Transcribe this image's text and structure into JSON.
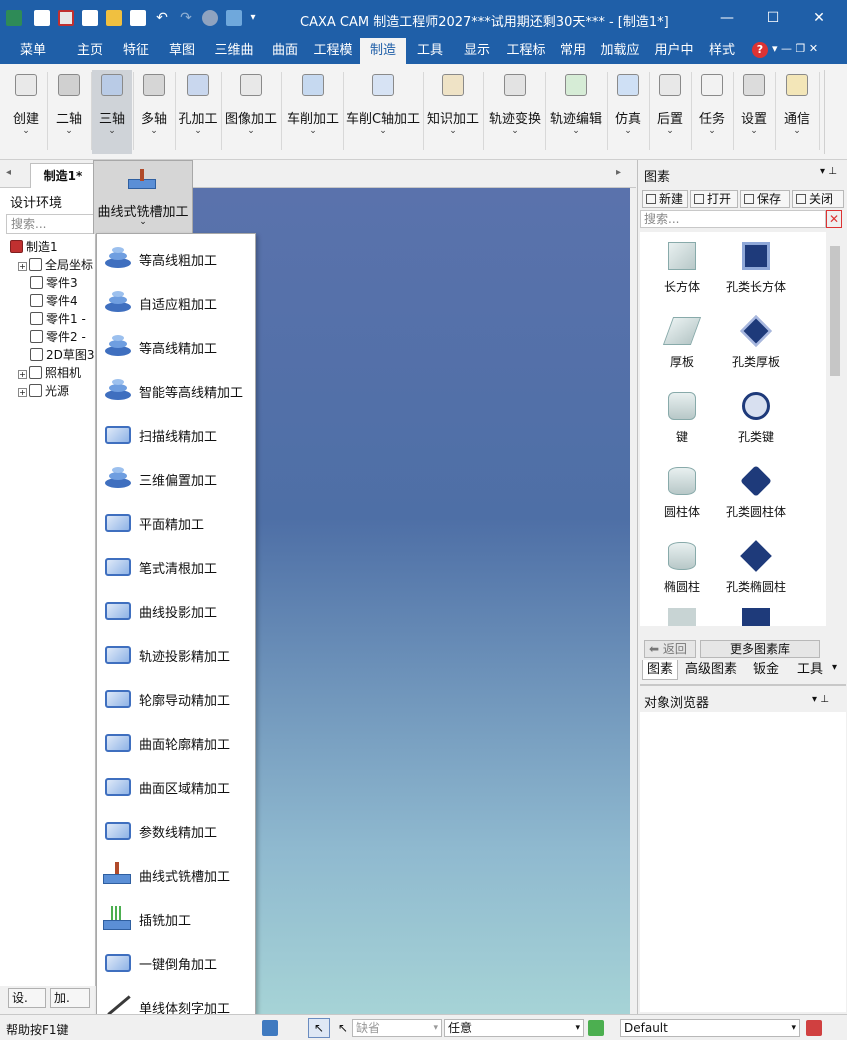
{
  "window": {
    "title": "CAXA CAM 制造工程师2027***试用期还剩30天*** - [制造1*]",
    "controls": {
      "minimize": "—",
      "maximize": "☐",
      "close": "✕"
    }
  },
  "menu_tabs": [
    "菜单",
    "主页",
    "特征",
    "草图",
    "三维曲",
    "曲面",
    "工程模",
    "制造",
    "工具",
    "显示",
    "工程标",
    "常用",
    "加载应",
    "用户中",
    "样式"
  ],
  "menu_active": "制造",
  "ribbon_buttons": [
    {
      "label": "创建",
      "icon": "create-icon"
    },
    {
      "label": "二轴",
      "icon": "two-axis-icon"
    },
    {
      "label": "三轴",
      "icon": "three-axis-icon"
    },
    {
      "label": "多轴",
      "icon": "multi-axis-icon"
    },
    {
      "label": "孔加工",
      "icon": "hole-icon"
    },
    {
      "label": "图像加工",
      "icon": "image-machining-icon"
    },
    {
      "label": "车削加工",
      "icon": "turning-icon"
    },
    {
      "label": "车削C轴加工",
      "icon": "c-axis-icon"
    },
    {
      "label": "知识加工",
      "icon": "knowledge-icon"
    },
    {
      "label": "轨迹变换",
      "icon": "path-transform-icon"
    },
    {
      "label": "轨迹编辑",
      "icon": "path-edit-icon"
    },
    {
      "label": "仿真",
      "icon": "simulation-icon"
    },
    {
      "label": "后置",
      "icon": "post-icon"
    },
    {
      "label": "任务",
      "icon": "task-icon"
    },
    {
      "label": "设置",
      "icon": "settings-icon"
    },
    {
      "label": "通信",
      "icon": "communication-icon"
    }
  ],
  "chevron": "⌄",
  "doc_tab": "制造1*",
  "left_panel": {
    "title": "设计环境",
    "search_placeholder": "搜索...",
    "tree": [
      "制造1",
      "全局坐标",
      "零件3",
      "零件4",
      "零件1 -",
      "零件2 -",
      "2D草图3",
      "照相机",
      "光源"
    ],
    "bottom_tabs": [
      "设.",
      "加."
    ]
  },
  "dropdown": {
    "header": "曲线式铣槽加工",
    "items": [
      "等高线粗加工",
      "自适应粗加工",
      "等高线精加工",
      "智能等高线精加工",
      "扫描线精加工",
      "三维偏置加工",
      "平面精加工",
      "笔式清根加工",
      "曲线投影加工",
      "轨迹投影精加工",
      "轮廓导动精加工",
      "曲面轮廓精加工",
      "曲面区域精加工",
      "参数线精加工",
      "曲线式铣槽加工",
      "插铣加工",
      "一键倒角加工",
      "单线体刻字加工"
    ]
  },
  "right_panel": {
    "title": "图素",
    "toolbar": [
      "新建",
      "打开",
      "保存",
      "关闭"
    ],
    "search_placeholder": "搜索...",
    "items": [
      "长方体",
      "孔类长方体",
      "厚板",
      "孔类厚板",
      "键",
      "孔类键",
      "圆柱体",
      "孔类圆柱体",
      "椭圆柱",
      "孔类椭圆柱"
    ],
    "back": "返回",
    "more": "更多图素库",
    "tabs": [
      "图素",
      "高级图素",
      "钣金",
      "工具"
    ],
    "object_browser": "对象浏览器"
  },
  "status": {
    "help": "帮助按F1键",
    "combo1": "缺省",
    "combo2": "任意",
    "combo3": "Default"
  },
  "colors": {
    "titlebar": "#1f5fa8",
    "accent": "#1f5fa8"
  }
}
